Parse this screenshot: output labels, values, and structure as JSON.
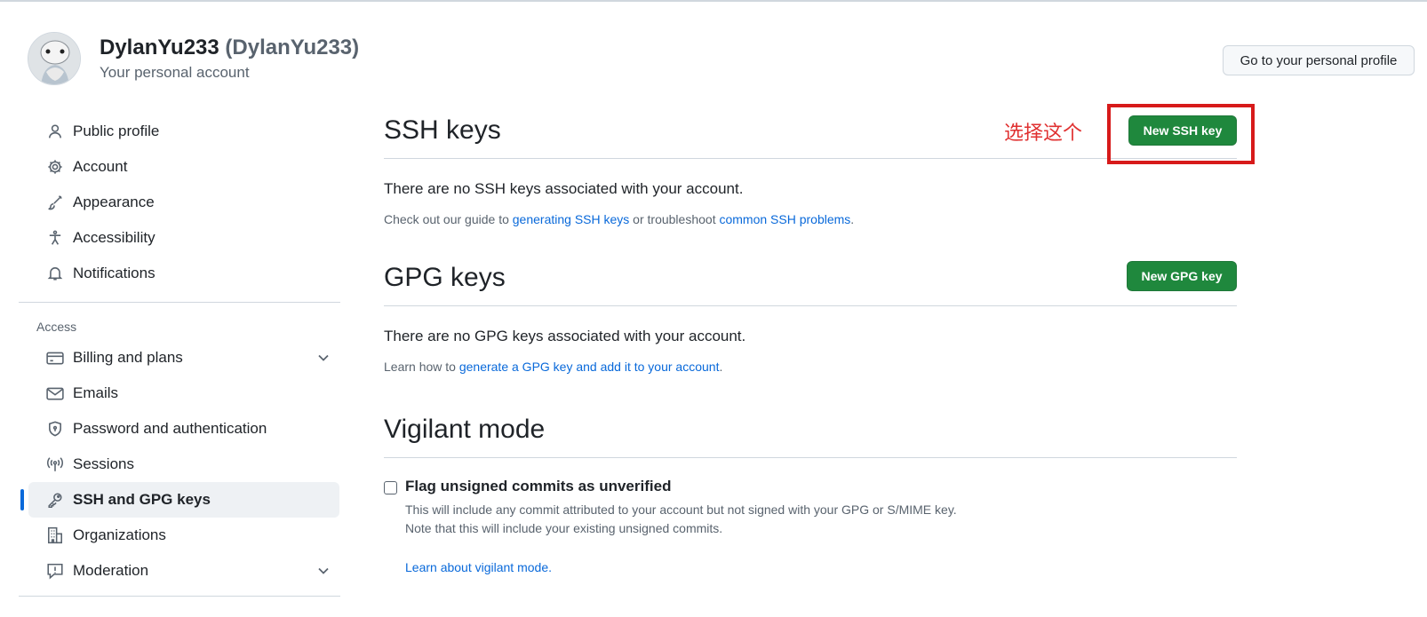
{
  "header": {
    "username": "DylanYu233",
    "handle": "(DylanYu233)",
    "subtitle": "Your personal account",
    "profile_button": "Go to your personal profile"
  },
  "sidebar": {
    "items": [
      {
        "label": "Public profile",
        "icon": "person-icon"
      },
      {
        "label": "Account",
        "icon": "gear-icon"
      },
      {
        "label": "Appearance",
        "icon": "paintbrush-icon"
      },
      {
        "label": "Accessibility",
        "icon": "accessibility-icon"
      },
      {
        "label": "Notifications",
        "icon": "bell-icon"
      }
    ],
    "access_label": "Access",
    "access_items": [
      {
        "label": "Billing and plans",
        "icon": "credit-card-icon",
        "expandable": true
      },
      {
        "label": "Emails",
        "icon": "mail-icon"
      },
      {
        "label": "Password and authentication",
        "icon": "shield-lock-icon"
      },
      {
        "label": "Sessions",
        "icon": "broadcast-icon"
      },
      {
        "label": "SSH and GPG keys",
        "icon": "key-icon",
        "active": true
      },
      {
        "label": "Organizations",
        "icon": "organization-icon"
      },
      {
        "label": "Moderation",
        "icon": "report-icon",
        "expandable": true
      }
    ]
  },
  "ssh": {
    "title": "SSH keys",
    "button": "New SSH key",
    "empty": "There are no SSH keys associated with your account.",
    "help_prefix": "Check out our guide to ",
    "help_link1": "generating SSH keys",
    "help_mid": " or troubleshoot ",
    "help_link2": "common SSH problems",
    "help_suffix": "."
  },
  "gpg": {
    "title": "GPG keys",
    "button": "New GPG key",
    "empty": "There are no GPG keys associated with your account.",
    "help_prefix": "Learn how to ",
    "help_link": "generate a GPG key and add it to your account",
    "help_suffix": "."
  },
  "vigilant": {
    "title": "Vigilant mode",
    "checkbox_label": "Flag unsigned commits as unverified",
    "checked": false,
    "desc1": "This will include any commit attributed to your account but not signed with your GPG or S/MIME key.",
    "desc2": "Note that this will include your existing unsigned commits.",
    "learn_link": "Learn about vigilant mode."
  },
  "annotation": {
    "text": "选择这个",
    "color": "#d71a1a"
  },
  "colors": {
    "primary_button": "#1f883d",
    "link": "#0969da",
    "active_indicator": "#0969da"
  }
}
